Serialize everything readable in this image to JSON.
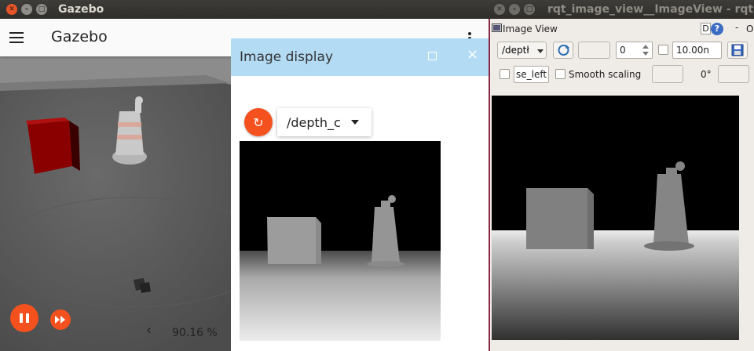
{
  "gazebo": {
    "window_title": "Gazebo",
    "app_title": "Gazebo",
    "zoom": "90.16 %",
    "back_chevron": "‹"
  },
  "image_display": {
    "title": "Image display",
    "topic": "/depth_c",
    "refresh_glyph": "↻"
  },
  "rqt": {
    "window_title": "rqt_image_view__ImageView - rqt",
    "plugin_title": "Image View",
    "topic": "/deptł",
    "number_value": "0",
    "max_value": "10.00n",
    "text_field": "se_left",
    "smooth_label": "Smooth scaling",
    "rotation": "0°",
    "help_d": "D",
    "help_q": "?",
    "dash": "-",
    "o": "O"
  },
  "colors": {
    "accent": "#f4511e",
    "panel_header": "#b3dbf4",
    "rqt_bg": "#efebe7"
  }
}
